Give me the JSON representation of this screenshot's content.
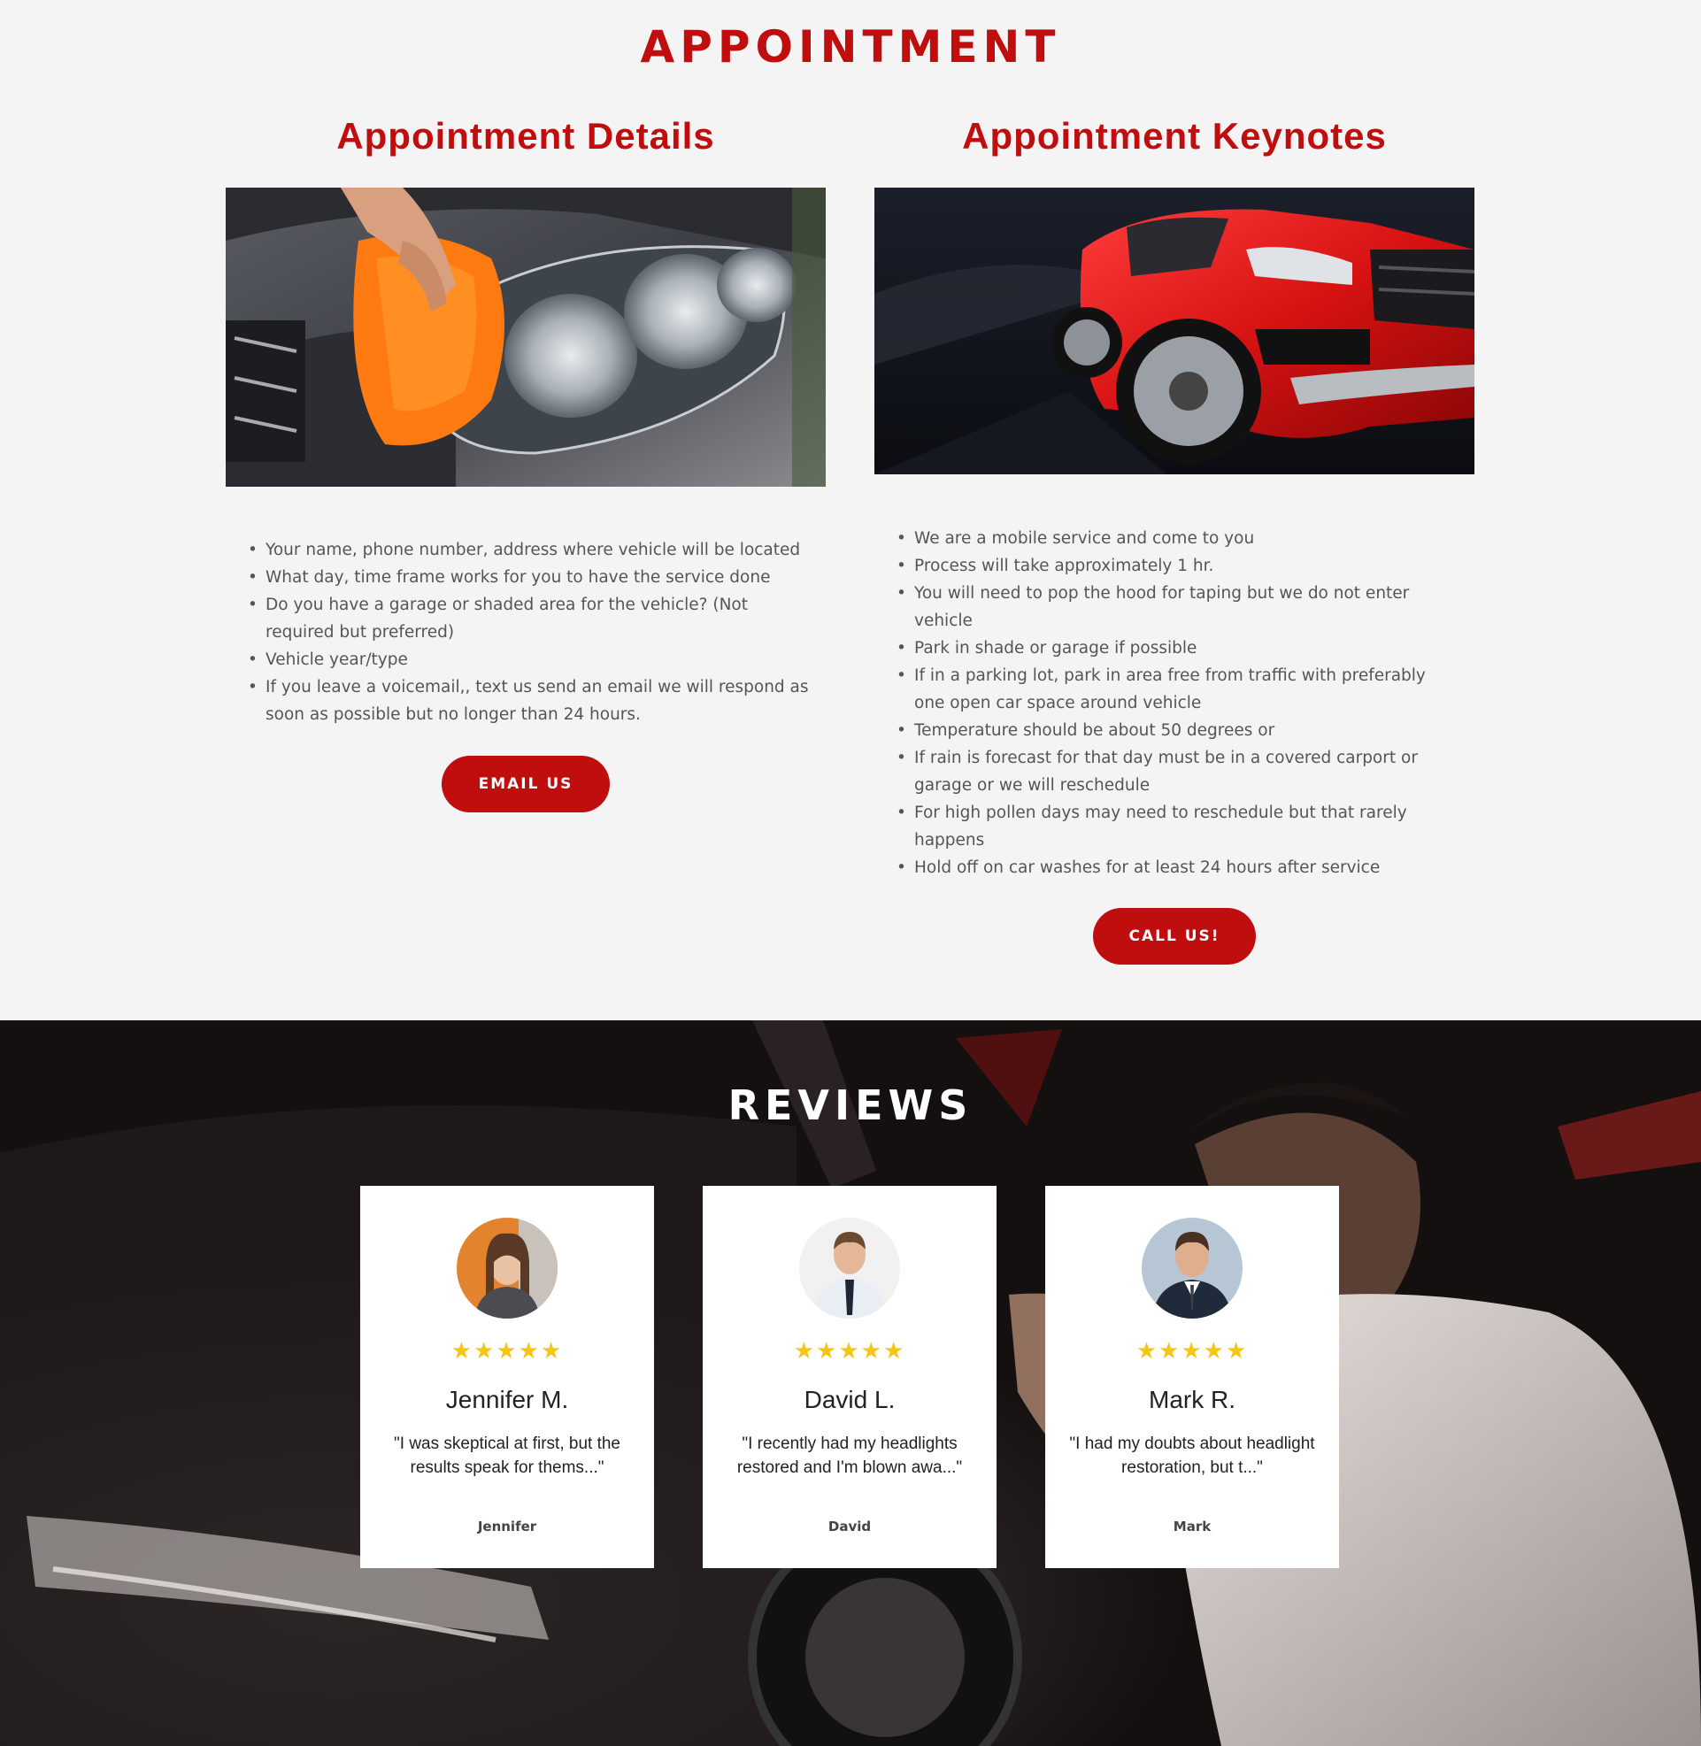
{
  "appointment": {
    "title": "APPOINTMENT",
    "details": {
      "heading": "Appointment Details",
      "items": [
        "Your name, phone number, address where vehicle will be located",
        "What day, time frame works for you to have the service done",
        "Do you have a garage or shaded area for the vehicle? (Not required but preferred)",
        "Vehicle year/type",
        "If you leave a voicemail,, text us  send an email we will respond as soon as possible but no longer than 24 hours."
      ],
      "button_label": "EMAIL US"
    },
    "keynotes": {
      "heading": "Appointment Keynotes",
      "items": [
        "We are a mobile service and come to you",
        "Process will take approximately 1 hr.",
        "You will need to pop the hood for taping but we do not enter vehicle",
        "Park in shade or garage if possible",
        "If in a parking lot, park in area free from traffic with preferably one open car space around vehicle",
        "Temperature should  be about 50 degrees or",
        "If rain is forecast for that day must be in a covered carport or garage or we will reschedule",
        "For high pollen days may need to reschedule but that rarely happens",
        "Hold off on car washes for at least 24 hours after service"
      ],
      "button_label": "CALL US!"
    }
  },
  "reviews": {
    "title": "REVIEWS",
    "cards": [
      {
        "stars": "★★★★★",
        "rating": 5,
        "name": "Jennifer M.",
        "quote": "\"I was skeptical at first, but the results speak for thems...\"",
        "author": "Jennifer"
      },
      {
        "stars": "★★★★★",
        "rating": 5,
        "name": "David L.",
        "quote": "\"I recently had my headlights restored and I'm blown awa...\"",
        "author": "David"
      },
      {
        "stars": "★★★★★",
        "rating": 5,
        "name": "Mark R.",
        "quote": "\"I had my doubts about headlight restoration, but t...\"",
        "author": "Mark"
      }
    ]
  },
  "colors": {
    "accent": "#c00d0d",
    "background": "#f4f4f4",
    "star": "#f5c518"
  }
}
